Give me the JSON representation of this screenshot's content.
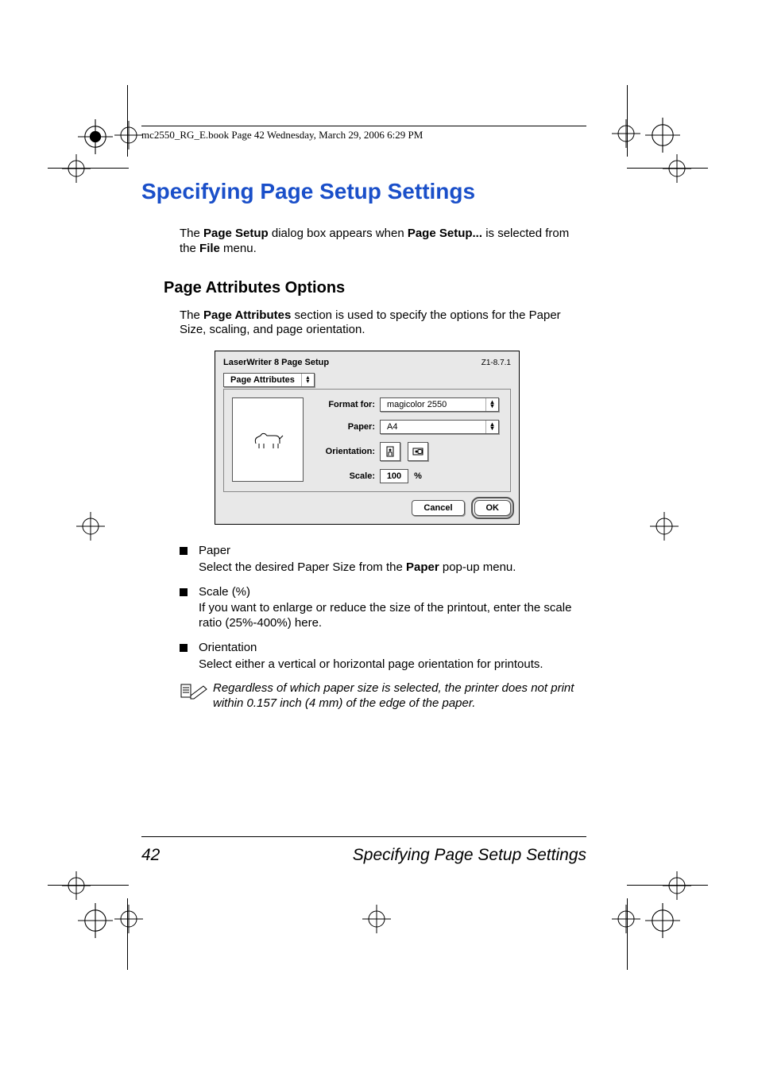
{
  "header_line": "mc2550_RG_E.book  Page 42  Wednesday, March 29, 2006  6:29 PM",
  "h1": "Specifying Page Setup Settings",
  "intro_parts": [
    "The ",
    "Page Setup",
    " dialog box appears when ",
    "Page Setup...",
    " is selected from the ",
    "File",
    " menu."
  ],
  "h2": "Page Attributes Options",
  "h2_body_parts": [
    "The ",
    "Page Attributes",
    " section is used to specify the options for the Paper Size, scaling, and page orientation."
  ],
  "dialog": {
    "title": "LaserWriter 8 Page Setup",
    "version": "Z1-8.7.1",
    "tab": "Page Attributes",
    "labels": {
      "format_for": "Format for:",
      "paper": "Paper:",
      "orientation": "Orientation:",
      "scale": "Scale:"
    },
    "values": {
      "format_for": "magicolor 2550",
      "paper": "A4",
      "scale": "100",
      "scale_unit": "%"
    },
    "buttons": {
      "cancel": "Cancel",
      "ok": "OK"
    }
  },
  "bullets": [
    {
      "title": "Paper",
      "body_parts": [
        "Select the desired Paper Size from the ",
        "Paper",
        " pop-up menu."
      ]
    },
    {
      "title": "Scale (%)",
      "body_parts": [
        "If you want to enlarge or reduce the size of the printout, enter the scale ratio (25%-400%) here."
      ]
    },
    {
      "title": "Orientation",
      "body_parts": [
        "Select either a vertical or horizontal page orientation for printouts."
      ]
    }
  ],
  "note": "Regardless of which paper size is selected, the printer does not print within 0.157 inch (4 mm) of the edge of the paper.",
  "footer": {
    "page": "42",
    "title": "Specifying Page Setup Settings"
  }
}
